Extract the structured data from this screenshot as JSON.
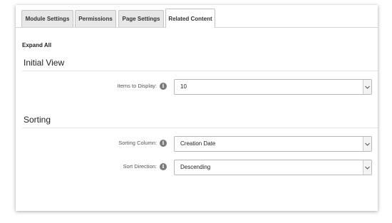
{
  "tabs": [
    {
      "label": "Module Settings",
      "active": false
    },
    {
      "label": "Permissions",
      "active": false
    },
    {
      "label": "Page Settings",
      "active": false
    },
    {
      "label": "Related Content",
      "active": true
    }
  ],
  "expand_all_label": "Expand All",
  "sections": {
    "initial_view": {
      "title": "Initial View",
      "fields": {
        "items_to_display": {
          "label": "Items to Display:",
          "value": "10"
        }
      }
    },
    "sorting": {
      "title": "Sorting",
      "fields": {
        "sorting_column": {
          "label": "Sorting Column:",
          "value": "Creation Date"
        },
        "sort_direction": {
          "label": "Sort Direction:",
          "value": "Descending"
        }
      }
    }
  },
  "icons": {
    "info": "info-icon",
    "dropdown": "chevron-down-icon"
  },
  "colors": {
    "tab_inactive_bg": "#e7e7e7",
    "info_icon_bg": "#7a7a7a"
  }
}
